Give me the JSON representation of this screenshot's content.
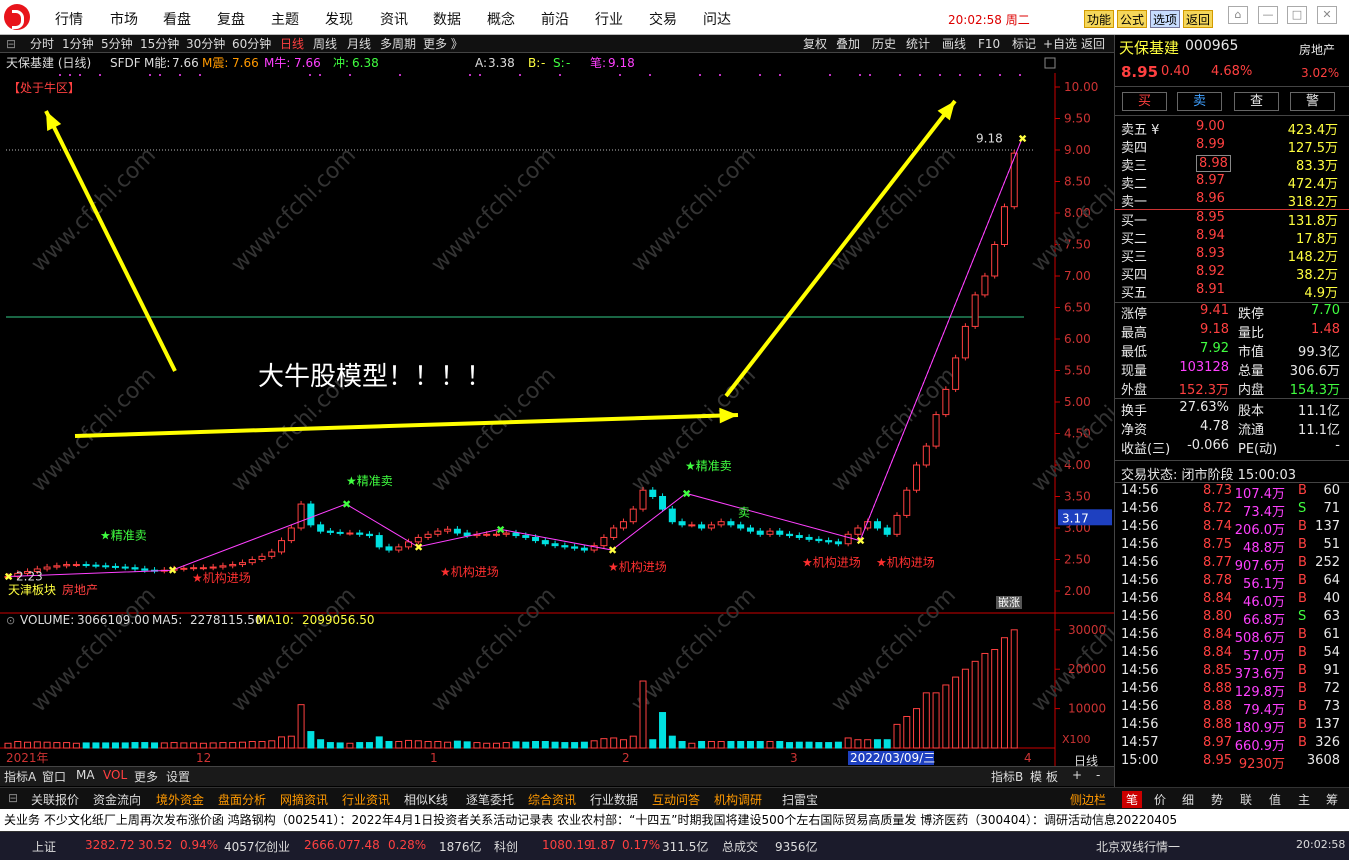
{
  "menu": {
    "items": [
      "行情",
      "市场",
      "看盘",
      "复盘",
      "主题",
      "发现",
      "资讯",
      "数据",
      "概念",
      "前沿",
      "行业",
      "交易",
      "问达"
    ],
    "func_btns": [
      "功能",
      "公式",
      "选项",
      "返回"
    ],
    "clock": "20:02:58 周二"
  },
  "toolbar": {
    "periods": [
      "分时",
      "1分钟",
      "5分钟",
      "15分钟",
      "30分钟",
      "60分钟",
      "日线",
      "周线",
      "月线",
      "多周期",
      "更多 》"
    ],
    "active": "日线",
    "right": [
      "复权",
      "叠加",
      "历史",
      "统计",
      "画线",
      "F10",
      "标记",
      "+自选",
      "返回"
    ]
  },
  "chart": {
    "title": "天保基建 (日线)",
    "indicator": "SFDF",
    "m_energy_label": "M能:",
    "m_energy": "7.66",
    "m_shock_label": "M震:",
    "m_shock": "7.66",
    "m_bull_label": "M牛:",
    "m_bull": "7.66",
    "rush_label": "冲:",
    "rush": "6.38",
    "a_label": "A:",
    "a_val": "3.38",
    "b_label": "B:",
    "b_val": "-",
    "s_label": "S:",
    "s_val": "-",
    "pen_label": "笔:",
    "pen_val": "9.18",
    "bull_zone": "【处于牛区】",
    "headline": "大牛股模型！！！！",
    "high_marker": "9.18",
    "last_price_tag": "3.17",
    "low_marker": "2.23",
    "y_ticks": [
      "10.00",
      "9.50",
      "9.00",
      "8.50",
      "8.00",
      "7.50",
      "7.00",
      "6.50",
      "6.00",
      "5.50",
      "5.00",
      "4.50",
      "4.00",
      "3.50",
      "3.00",
      "2.50",
      "2.00"
    ],
    "sell_labels": [
      "★精准卖",
      "★精准卖",
      "★精准卖",
      "卖"
    ],
    "buy_labels": [
      "★机构进场",
      "★机构进场",
      "★机构进场",
      "★机构进场",
      "★机构进场"
    ],
    "sector": "天津板块",
    "sector2": "房地产",
    "watermark": "www.cfchi.com",
    "badge": "嵌涨"
  },
  "volume": {
    "label": "VOLUME:",
    "value": "3066109.00",
    "ma5_label": "MA5:",
    "ma5": "2278115.50",
    "ma10_label": "MA10:",
    "ma10": "2099056.50",
    "y_ticks": [
      "30000",
      "20000",
      "10000"
    ],
    "unit": "X100",
    "x_labels": [
      "2021年",
      "12",
      "1",
      "2",
      "3",
      "4"
    ],
    "date_tag": "2022/03/09/三",
    "right_tab": "日线"
  },
  "bottom_tabs": {
    "left": [
      "指标A",
      "窗口",
      "MA",
      "VOL",
      "更多",
      "设置"
    ],
    "right": [
      "指标B",
      "模",
      "板",
      "+",
      "-"
    ]
  },
  "tabs2": {
    "items": [
      "关联报价",
      "资金流向",
      "境外资金",
      "盘面分析",
      "网摘资讯",
      "行业资讯",
      "相似K线",
      "逐笔委托",
      "综合资讯",
      "行业数据",
      "互动问答",
      "机构调研",
      "扫雷宝"
    ],
    "side": "侧边栏"
  },
  "right_tabs": [
    "笔",
    "价",
    "细",
    "势",
    "联",
    "值",
    "主",
    "筹"
  ],
  "news": "关业务   不少文化纸厂上周再次发布涨价函   鸿路钢构（002541）：2022年4月1日投资者关系活动记录表   农业农村部：“十四五”时期我国将建设500个左右国际贸易高质量发   博济医药（300404）：调研活动信息20220405",
  "status": {
    "items": [
      "上证",
      "3282.72",
      "30.52",
      "0.94%",
      "4057亿",
      "创业",
      "2666.07",
      "7.48",
      "0.28%",
      "1876亿",
      "科创",
      "1080.19",
      "1.87",
      "0.17%",
      "311.5亿",
      "总成交",
      "9356亿"
    ],
    "right": "北京双线行情一",
    "time": "20:02:58"
  },
  "stock": {
    "name": "天保基建",
    "code": "000965",
    "sector": "房地产",
    "price": "8.95",
    "change": "0.40",
    "pct": "4.68%",
    "sector_pct": "3.02%",
    "actions": [
      "买",
      "卖",
      "查",
      "警"
    ],
    "asks": [
      {
        "l": "卖五 ¥",
        "p": "9.00",
        "v": "423.4万"
      },
      {
        "l": "卖四",
        "p": "8.99",
        "v": "127.5万"
      },
      {
        "l": "卖三",
        "p": "8.98",
        "v": "83.3万"
      },
      {
        "l": "卖二",
        "p": "8.97",
        "v": "472.4万"
      },
      {
        "l": "卖一",
        "p": "8.96",
        "v": "318.2万"
      }
    ],
    "bids": [
      {
        "l": "买一",
        "p": "8.95",
        "v": "131.8万"
      },
      {
        "l": "买二",
        "p": "8.94",
        "v": "17.8万"
      },
      {
        "l": "买三",
        "p": "8.93",
        "v": "148.2万"
      },
      {
        "l": "买四",
        "p": "8.92",
        "v": "38.2万"
      },
      {
        "l": "买五",
        "p": "8.91",
        "v": "4.9万"
      }
    ],
    "stats": [
      [
        "涨停",
        "9.41",
        "跌停",
        "7.70"
      ],
      [
        "最高",
        "9.18",
        "量比",
        "1.48"
      ],
      [
        "最低",
        "7.92",
        "市值",
        "99.3亿"
      ],
      [
        "现量",
        "103128",
        "总量",
        "306.6万"
      ],
      [
        "外盘",
        "152.3万",
        "内盘",
        "154.3万"
      ],
      [
        "换手",
        "27.63%",
        "股本",
        "11.1亿"
      ],
      [
        "净资",
        "4.78",
        "流通",
        "11.1亿"
      ],
      [
        "收益(三)",
        "-0.066",
        "PE(动)",
        "-"
      ]
    ],
    "trade_status": "交易状态: 闭市阶段 15:00:03",
    "ticks": [
      [
        "14:56",
        "8.73",
        "107.4万",
        "B",
        "60"
      ],
      [
        "14:56",
        "8.72",
        "73.4万",
        "S",
        "71"
      ],
      [
        "14:56",
        "8.74",
        "206.0万",
        "B",
        "137"
      ],
      [
        "14:56",
        "8.75",
        "48.8万",
        "B",
        "51"
      ],
      [
        "14:56",
        "8.77",
        "907.6万",
        "B",
        "252"
      ],
      [
        "14:56",
        "8.78",
        "56.1万",
        "B",
        "64"
      ],
      [
        "14:56",
        "8.84",
        "46.0万",
        "B",
        "40"
      ],
      [
        "14:56",
        "8.80",
        "66.8万",
        "S",
        "63"
      ],
      [
        "14:56",
        "8.84",
        "508.6万",
        "B",
        "61"
      ],
      [
        "14:56",
        "8.84",
        "57.0万",
        "B",
        "54"
      ],
      [
        "14:56",
        "8.85",
        "373.6万",
        "B",
        "91"
      ],
      [
        "14:56",
        "8.88",
        "129.8万",
        "B",
        "72"
      ],
      [
        "14:56",
        "8.88",
        "79.4万",
        "B",
        "73"
      ],
      [
        "14:56",
        "8.88",
        "180.9万",
        "B",
        "137"
      ],
      [
        "14:57",
        "8.97",
        "660.9万",
        "B",
        "326"
      ],
      [
        "15:00",
        "8.95",
        "9230万",
        "",
        "3608"
      ]
    ]
  }
}
